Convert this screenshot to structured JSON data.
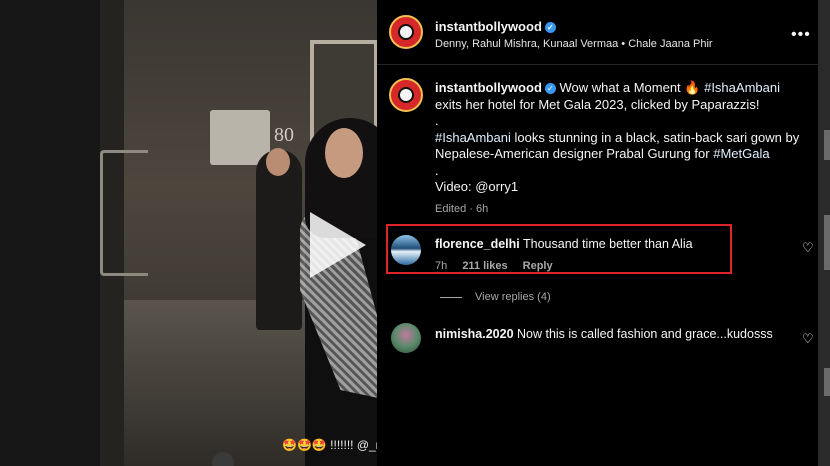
{
  "post": {
    "author": "instantbollywood",
    "audio": "Denny, Rahul Mishra, Kunaal Vermaa • Chale Jaana Phir",
    "verified_icon": "verified-badge-icon",
    "more_icon": "more-options-icon",
    "more_label": "•••"
  },
  "caption": {
    "author": "instantbollywood",
    "line1_text": "Wow what a Moment",
    "fire_emoji": "🔥",
    "hashtag1": "#IshaAmbani",
    "line1_rest": "exits her hotel for Met Gala 2023, clicked by Paparazzis!",
    "dot1": ".",
    "hashtag2": "#IshaAmbani",
    "line2_rest": "looks stunning in a black, satin-back sari gown by Nepalese-American designer Prabal Gurung for",
    "hashtag3": "#MetGala",
    "dot2": ".",
    "video_credit": "Video: @orry1",
    "edited": "Edited",
    "edited_sep": "·",
    "edited_time": "6h"
  },
  "comments": [
    {
      "user": "florence_delhi",
      "text": "Thousand time better than Alia",
      "time": "7h",
      "likes": "211 likes",
      "reply": "Reply",
      "view_replies": "View replies (4)"
    },
    {
      "user": "nimisha.2020",
      "text": "Now this is called fashion and grace...kudosss"
    }
  ],
  "video": {
    "overlay_caption": "🤩🤩🤩 !!!!!!! @_nishamagish",
    "sign_text": "80"
  },
  "colors": {
    "highlight": "#e0222a",
    "verified": "#3897f0"
  }
}
